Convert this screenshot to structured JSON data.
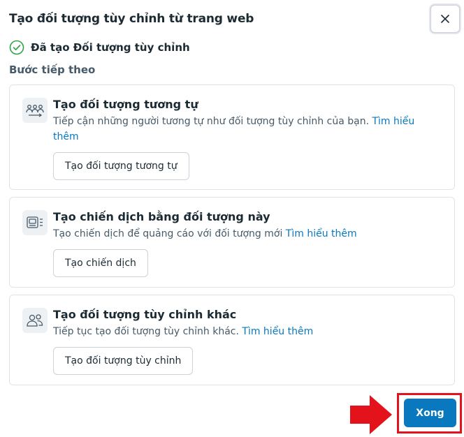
{
  "dialog": {
    "title": "Tạo đối tượng tùy chỉnh từ trang web",
    "close_icon": "close-icon"
  },
  "success": {
    "icon": "check-circle-icon",
    "label": "Đã tạo Đối tượng tùy chỉnh"
  },
  "next_steps": {
    "label": "Bước tiếp theo",
    "cards": [
      {
        "icon": "people-group-icon",
        "title": "Tạo đối tượng tương tự",
        "description": "Tiếp cận những người tương tự như đối tượng tùy chỉnh của bạn. ",
        "link": "Tìm hiểu thêm",
        "button": "Tạo đối tượng tương tự"
      },
      {
        "icon": "campaign-icon",
        "title": "Tạo chiến dịch bằng đối tượng này",
        "description": "Tạo chiến dịch để quảng cáo với đối tượng mới ",
        "link": "Tìm hiểu thêm",
        "button": "Tạo chiến dịch"
      },
      {
        "icon": "people-icon",
        "title": "Tạo đối tượng tùy chỉnh khác",
        "description": "Tiếp tục tạo đối tượng tùy chỉnh khác. ",
        "link": "Tìm hiểu thêm",
        "button": "Tạo đối tượng tùy chỉnh"
      }
    ]
  },
  "footer": {
    "done_label": "Xong"
  },
  "colors": {
    "primary": "#0a78be",
    "annotation_red": "#e4121b",
    "success_green": "#31a24c"
  }
}
